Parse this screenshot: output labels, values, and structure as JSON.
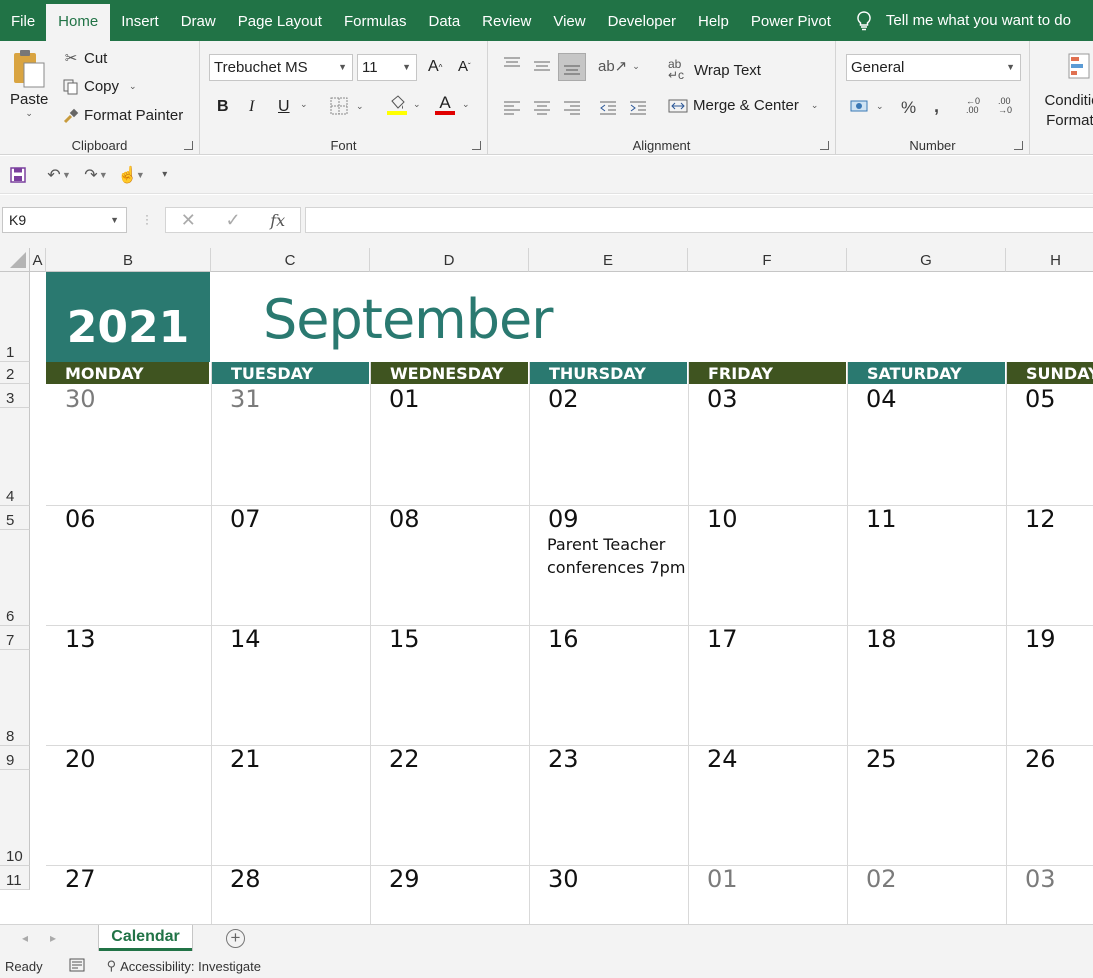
{
  "ribbon_tabs": [
    "File",
    "Home",
    "Insert",
    "Draw",
    "Page Layout",
    "Formulas",
    "Data",
    "Review",
    "View",
    "Developer",
    "Help",
    "Power Pivot"
  ],
  "tell_me": "Tell me what you want to do",
  "clipboard": {
    "paste": "Paste",
    "cut": "Cut",
    "copy": "Copy",
    "format_painter": "Format Painter",
    "label": "Clipboard"
  },
  "font": {
    "name": "Trebuchet MS",
    "size": "11",
    "bold": "B",
    "italic": "I",
    "underline": "U",
    "label": "Font",
    "highlight_color": "#ffff00",
    "font_color": "#e00000"
  },
  "alignment": {
    "wrap_text": "Wrap Text",
    "merge_center": "Merge & Center",
    "label": "Alignment"
  },
  "number": {
    "format": "General",
    "percent": "%",
    "comma": ",",
    "label": "Number"
  },
  "styles": {
    "conditional": "Conditional Formatting"
  },
  "name_box": "K9",
  "formula": "",
  "columns": [
    "A",
    "B",
    "C",
    "D",
    "E",
    "F",
    "G",
    "H"
  ],
  "rows": [
    "1",
    "2",
    "3",
    "4",
    "5",
    "6",
    "7",
    "8",
    "9",
    "10",
    "11"
  ],
  "calendar": {
    "year": "2021",
    "month": "September",
    "days": [
      "MONDAY",
      "TUESDAY",
      "WEDNESDAY",
      "THURSDAY",
      "FRIDAY",
      "SATURDAY",
      "SUNDAY"
    ],
    "weeks": [
      [
        {
          "d": "30",
          "m": true
        },
        {
          "d": "31",
          "m": true
        },
        {
          "d": "01"
        },
        {
          "d": "02"
        },
        {
          "d": "03"
        },
        {
          "d": "04"
        },
        {
          "d": "05"
        }
      ],
      [
        {
          "d": "06"
        },
        {
          "d": "07"
        },
        {
          "d": "08"
        },
        {
          "d": "09"
        },
        {
          "d": "10"
        },
        {
          "d": "11"
        },
        {
          "d": "12"
        }
      ],
      [
        {
          "d": "13"
        },
        {
          "d": "14"
        },
        {
          "d": "15"
        },
        {
          "d": "16"
        },
        {
          "d": "17"
        },
        {
          "d": "18"
        },
        {
          "d": "19"
        }
      ],
      [
        {
          "d": "20"
        },
        {
          "d": "21"
        },
        {
          "d": "22"
        },
        {
          "d": "23"
        },
        {
          "d": "24"
        },
        {
          "d": "25"
        },
        {
          "d": "26"
        }
      ],
      [
        {
          "d": "27"
        },
        {
          "d": "28"
        },
        {
          "d": "29"
        },
        {
          "d": "30"
        },
        {
          "d": "01",
          "m": true
        },
        {
          "d": "02",
          "m": true
        },
        {
          "d": "03",
          "m": true
        }
      ]
    ],
    "event_line1": "Parent Teacher",
    "event_line2": "conferences 7pm",
    "teal": "#2a7970",
    "olive": "#3f5420"
  },
  "sheet_tab": "Calendar",
  "status": {
    "ready": "Ready",
    "accessibility": "Accessibility: Investigate"
  }
}
